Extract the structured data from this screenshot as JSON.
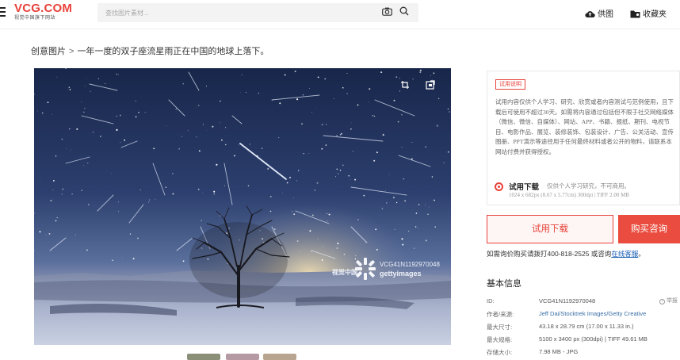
{
  "header": {
    "logo_main": "VCG.COM",
    "logo_sub": "视觉中国旗下网站",
    "search_placeholder": "查找图片素材...",
    "supply_label": "供图",
    "favorites_label": "收藏夹"
  },
  "breadcrumb": {
    "root": "创意图片",
    "separator": ">",
    "current": "一年一度的双子座流星雨正在中国的地球上落下。"
  },
  "photo": {
    "watermark_code": "VCG41N1192970048",
    "watermark_brand": "gettyimages",
    "watermark_vcg": "视觉中国",
    "tools": [
      "crop-icon",
      "similar-search-icon"
    ]
  },
  "trial": {
    "tag": "试用说明",
    "description": "试用内容仅供个人学习、研究、欣赏或者内容测试与范例使用，且下载后可使用不超过30天。如需将内容通过包括但不限于社交网络媒体（微信、微信、自媒体）、网站、APP、书籍、报纸、期刊、电视节目、电影作品、展览、装修装饰、包装设计、广告、公关活动、宣传图册、PPT演示等途径用于任何最终材料或者公开的物料，请联系本网站付费并获得授权。",
    "option_title": "试用下载",
    "option_note": "仅供个人学习研究，不可商用。",
    "option_spec": "1024 x 682px (8.67 x 5.77cm) 300dpi | TIFF 2.00 MB"
  },
  "actions": {
    "trial_download": "试用下载",
    "buy_consult": "购买咨询"
  },
  "consult": {
    "text": "如需询价购买请拨打400-818-2525 或咨询",
    "link": "在线客服",
    "end": "。"
  },
  "info": {
    "title": "基本信息",
    "report_label": "举报",
    "rows": [
      {
        "key": "ID:",
        "value": "VCG41N1192970048"
      },
      {
        "key": "作者/来源:",
        "value": "Jeff Dai/Stocktrek Images/Getty Creative"
      },
      {
        "key": "最大尺寸:",
        "value": "43.18 x 28.79 cm (17.00 x 11.33 in.)"
      },
      {
        "key": "最大规格:",
        "value": "5100 x 3400 px (300dpi) | TIFF 49.61 MB"
      },
      {
        "key": "存储大小:",
        "value": "7.98 MB - JPG"
      }
    ]
  },
  "colors": {
    "accent": "#e8423a",
    "link": "#1a5fb4"
  }
}
